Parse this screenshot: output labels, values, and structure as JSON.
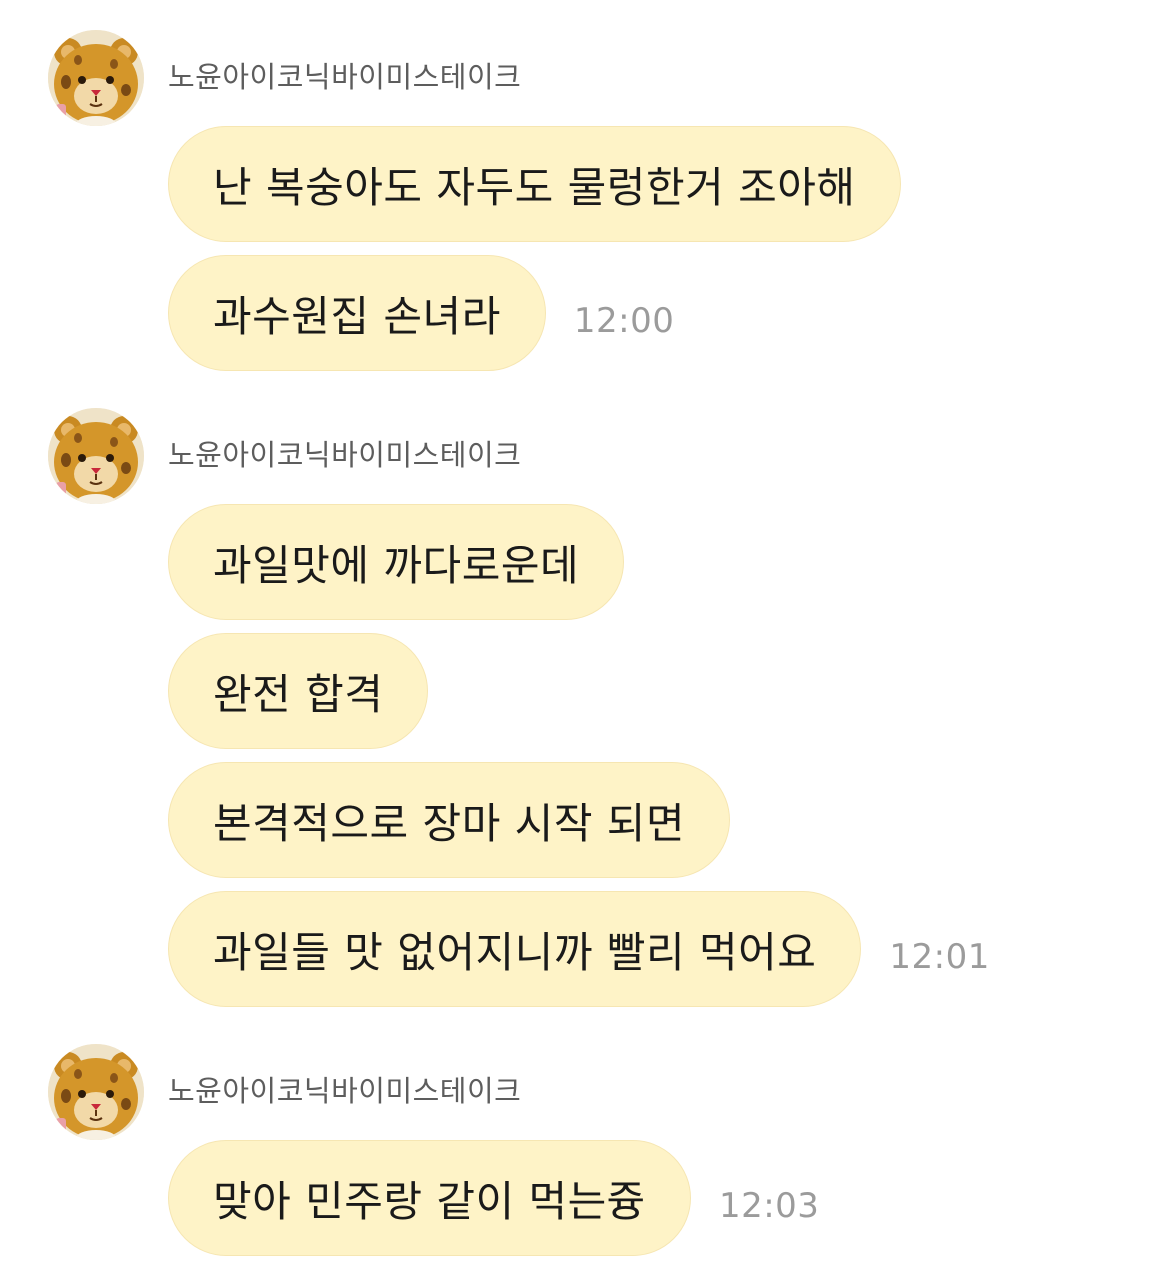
{
  "colors": {
    "bubble_background": "#fef3c7",
    "sender_text": "#5d5d5d",
    "timestamp_text": "#9b9b9b",
    "message_text": "#1a1a1a"
  },
  "groups": [
    {
      "sender": "노윤아이코닉바이미스테이크",
      "avatar_icon": "teddy-bear-avatar-icon",
      "messages": [
        {
          "text": "난 복숭아도 자두도 물렁한거 조아해",
          "time": ""
        },
        {
          "text": "과수원집 손녀라",
          "time": "12:00"
        }
      ]
    },
    {
      "sender": "노윤아이코닉바이미스테이크",
      "avatar_icon": "teddy-bear-avatar-icon",
      "messages": [
        {
          "text": "과일맛에 까다로운데",
          "time": ""
        },
        {
          "text": "완전 합격",
          "time": ""
        },
        {
          "text": "본격적으로 장마 시작 되면",
          "time": ""
        },
        {
          "text": "과일들 맛 없어지니까 빨리 먹어요",
          "time": "12:01"
        }
      ]
    },
    {
      "sender": "노윤아이코닉바이미스테이크",
      "avatar_icon": "teddy-bear-avatar-icon",
      "messages": [
        {
          "text": "맞아 민주랑 같이 먹는즁",
          "time": "12:03"
        }
      ]
    }
  ]
}
